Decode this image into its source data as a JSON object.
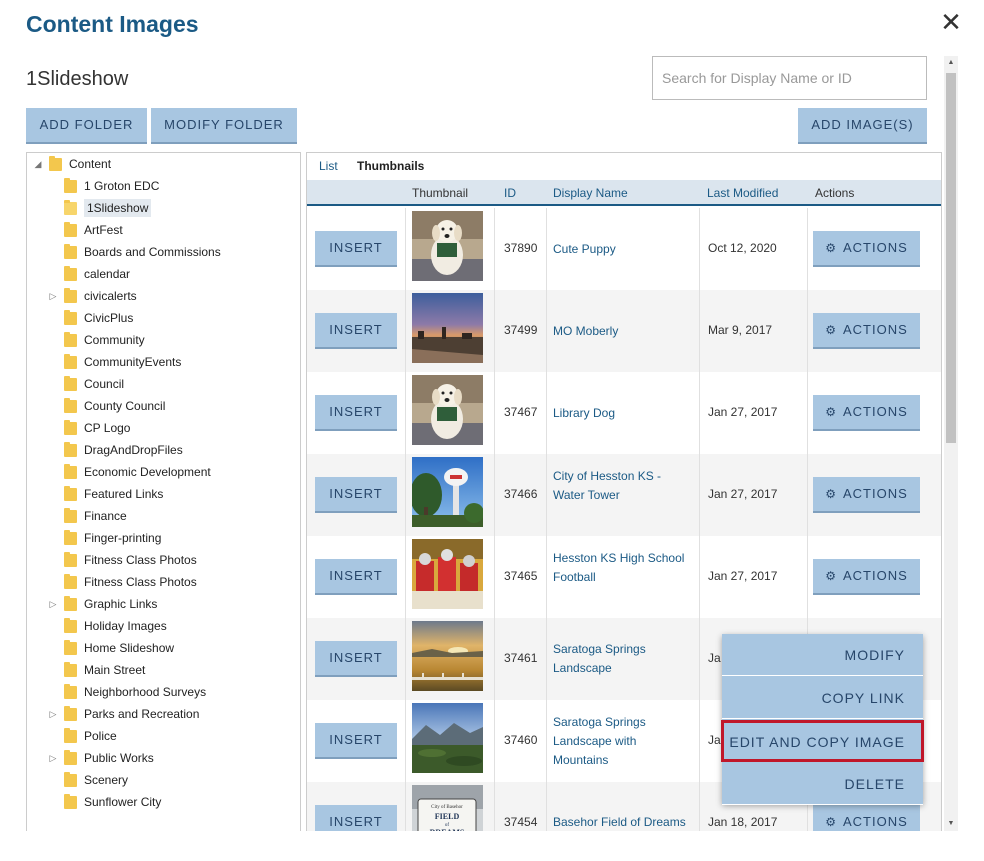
{
  "dialog": {
    "title": "Content Images",
    "close_label": "✕"
  },
  "folder": {
    "name": "1Slideshow"
  },
  "search": {
    "placeholder": "Search for Display Name or ID",
    "value": ""
  },
  "toolbar": {
    "add_folder": "ADD FOLDER",
    "modify_folder": "MODIFY FOLDER",
    "add_images": "ADD IMAGE(S)"
  },
  "tree": {
    "root": "Content",
    "items": [
      "1 Groton EDC",
      "1Slideshow",
      "ArtFest",
      "Boards and Commissions",
      "calendar",
      "civicalerts",
      "CivicPlus",
      "Community",
      "CommunityEvents",
      "Council",
      "County Council",
      "CP Logo",
      "DragAndDropFiles",
      "Economic Development",
      "Featured Links",
      "Finance",
      "Finger-printing",
      "Fitness Class Photos",
      "Fitness Class Photos",
      "Graphic Links",
      "Holiday Images",
      "Home Slideshow",
      "Main Street",
      "Neighborhood Surveys",
      "Parks and Recreation",
      "Police",
      "Public Works",
      "Scenery",
      "Sunflower City"
    ],
    "selected": "1Slideshow",
    "expandable": [
      "civicalerts",
      "Graphic Links",
      "Parks and Recreation",
      "Public Works"
    ]
  },
  "tabs": {
    "list": "List",
    "thumbnails": "Thumbnails"
  },
  "table": {
    "headers": {
      "thumbnail": "Thumbnail",
      "id": "ID",
      "name": "Display Name",
      "modified": "Last Modified",
      "actions": "Actions"
    },
    "insert_label": "INSERT",
    "actions_label": "ACTIONS",
    "rows": [
      {
        "id": "37890",
        "name": "Cute Puppy",
        "modified": "Oct 12, 2020",
        "thumb": "puppy"
      },
      {
        "id": "37499",
        "name": "MO Moberly",
        "modified": "Mar 9, 2017",
        "thumb": "sunset-town"
      },
      {
        "id": "37467",
        "name": "Library Dog",
        "modified": "Jan 27, 2017",
        "thumb": "puppy"
      },
      {
        "id": "37466",
        "name": "City of Hesston KS - Water Tower",
        "modified": "Jan 27, 2017",
        "thumb": "water-tower"
      },
      {
        "id": "37465",
        "name": "Hesston KS High School Football",
        "modified": "Jan 27, 2017",
        "thumb": "football"
      },
      {
        "id": "37461",
        "name": "Saratoga Springs Landscape",
        "modified": "Ja",
        "thumb": "landscape"
      },
      {
        "id": "37460",
        "name": "Saratoga Springs Landscape with Mountains",
        "modified": "Ja",
        "thumb": "mountains"
      },
      {
        "id": "37454",
        "name": "Basehor Field of Dreams",
        "modified": "Jan 18, 2017",
        "thumb": "sign"
      }
    ]
  },
  "sign_text": "City of Basehor FIELD of DREAMS",
  "actions_menu": {
    "items": [
      "MODIFY",
      "COPY LINK",
      "EDIT AND COPY IMAGE",
      "DELETE"
    ],
    "highlighted": "EDIT AND COPY IMAGE"
  },
  "colors": {
    "primary": "#1b5a85",
    "button": "#a8c6e1",
    "highlight": "#c0172a"
  }
}
